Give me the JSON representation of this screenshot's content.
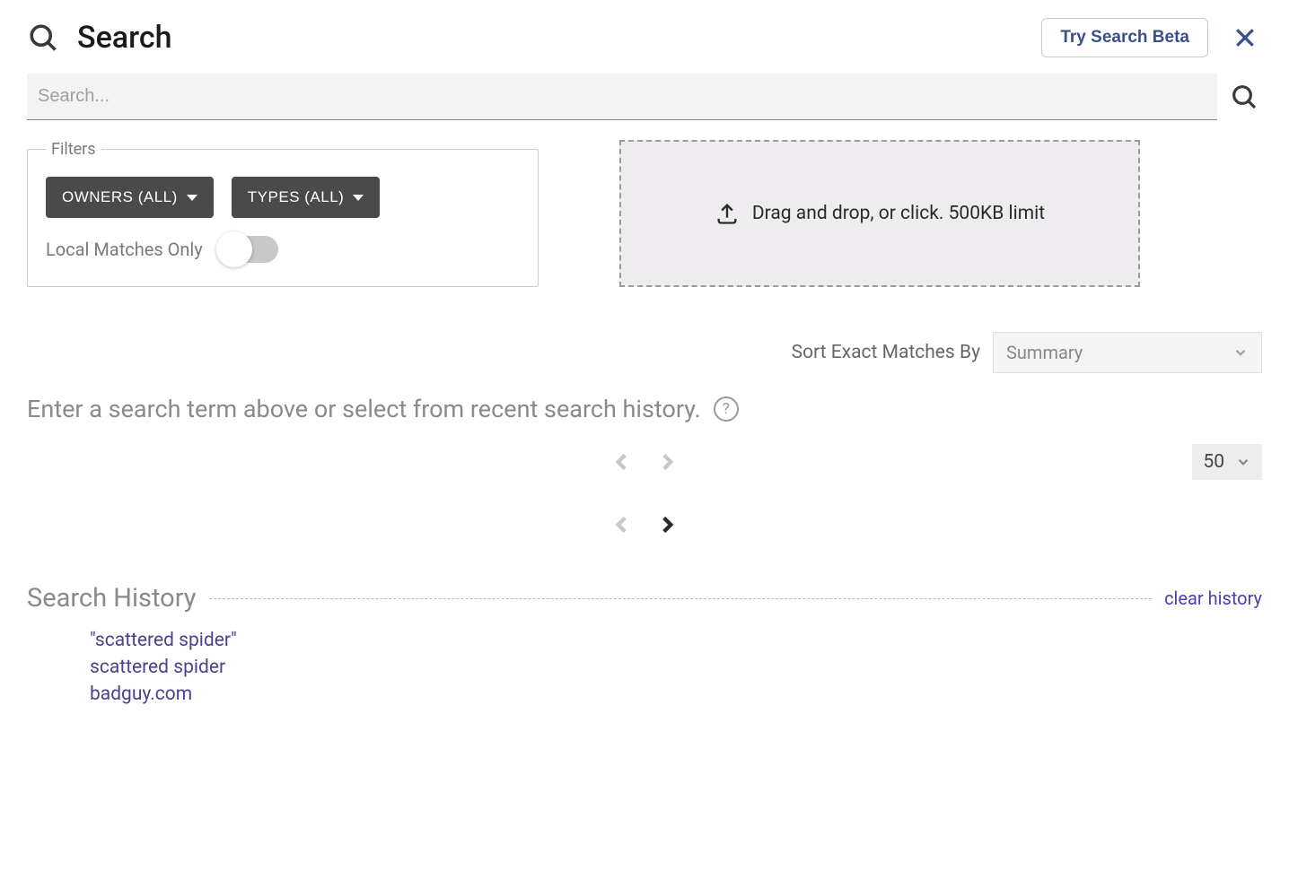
{
  "header": {
    "title": "Search",
    "try_beta_label": "Try Search Beta"
  },
  "search": {
    "placeholder": "Search...",
    "value": ""
  },
  "filters": {
    "legend": "Filters",
    "owners_label": "OWNERS (ALL)",
    "types_label": "TYPES (ALL)",
    "local_matches_label": "Local Matches Only",
    "local_matches_on": false
  },
  "dropzone": {
    "text": "Drag and drop, or click. 500KB limit"
  },
  "sort": {
    "label": "Sort Exact Matches By",
    "selected": "Summary"
  },
  "prompt": {
    "text": "Enter a search term above or select from recent search history."
  },
  "pager": {
    "page_size": "50"
  },
  "history": {
    "title": "Search History",
    "clear_label": "clear history",
    "items": [
      "\"scattered spider\"",
      "scattered spider",
      "badguy.com"
    ]
  }
}
